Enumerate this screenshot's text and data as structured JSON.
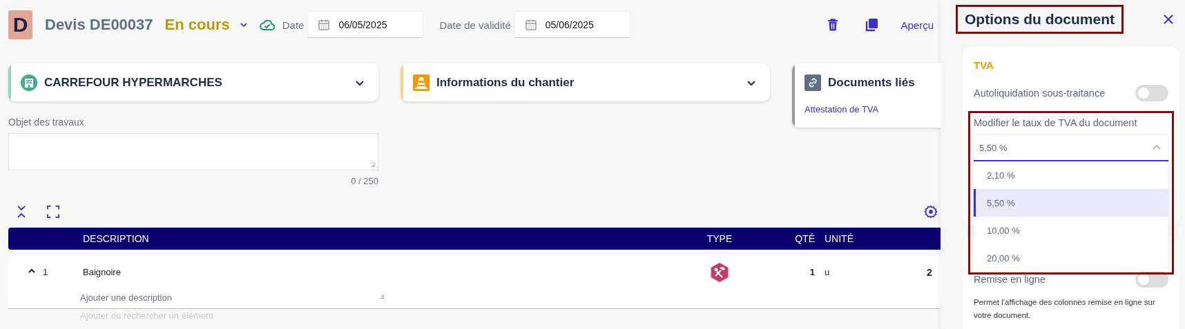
{
  "header": {
    "avatar": "D",
    "title": "Devis DE00037",
    "status": "En cours",
    "date_label": "Date",
    "date": "06/05/2025",
    "validity_label": "Date de validité",
    "validity_date": "05/06/2025",
    "preview": "Aperçu"
  },
  "cards": [
    {
      "kind": "client",
      "title": "CARREFOUR HYPERMARCHES",
      "color": "#8fd9c4"
    },
    {
      "kind": "site",
      "title": "Informations du chantier",
      "color": "#ffd08a"
    },
    {
      "kind": "documents",
      "title": "Documents liés",
      "color": "#9a9a9a",
      "link": "Attestation de TVA"
    }
  ],
  "work_object": {
    "label": "Objet des travaux",
    "counter": "0 / 250"
  },
  "table": {
    "columns": [
      "DESCRIPTION",
      "TYPE",
      "QTÉ",
      "UNITÉ"
    ],
    "rows": [
      {
        "expanded": true,
        "number": "1",
        "description": "Baignoire",
        "kind": "labour",
        "qty": "1",
        "unit": "u",
        "column_5": "2",
        "description_placeholder": "Ajouter une description"
      }
    ],
    "add_placeholder": "Ajouter ou rechercher un élément"
  },
  "panel": {
    "title": "Options du document",
    "title_highlighted": true,
    "tva": {
      "heading": "TVA",
      "reverse_charge": {
        "label": "Autoliquidation sous-traitance",
        "on": false
      },
      "rate": {
        "label": "Modifier le taux de TVA du document",
        "value": "5,50 %",
        "expanded": true,
        "highlighted": true,
        "options": [
          {
            "label": "2,10 %",
            "selected": false
          },
          {
            "label": "5,50 %",
            "selected": true
          },
          {
            "label": "10,00 %",
            "selected": false
          },
          {
            "label": "20,00 %",
            "selected": false
          }
        ]
      }
    },
    "line_discount": {
      "label": "Remise en ligne",
      "on": false,
      "help": "Permet l'affichage des colonnes remise en ligne sur votre document."
    }
  }
}
